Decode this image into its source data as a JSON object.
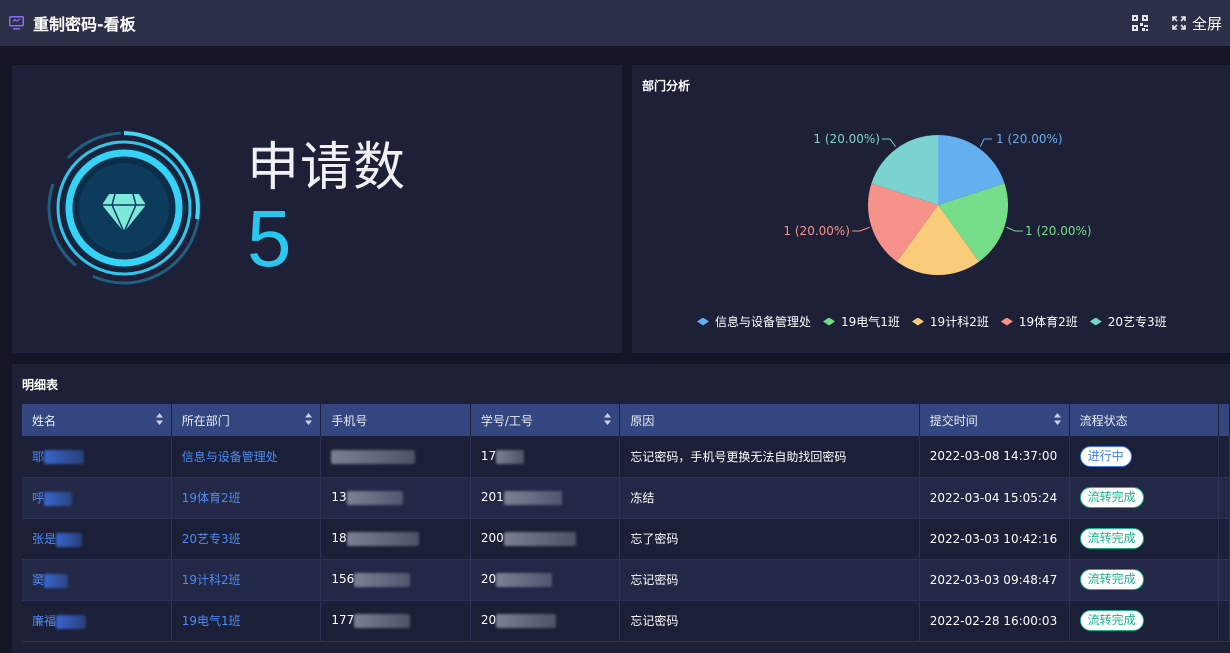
{
  "header": {
    "title": "重制密码-看板",
    "fullscreen_label": "全屏",
    "icons": [
      "monitor-icon",
      "qrcode-icon",
      "fullscreen-icon"
    ]
  },
  "stat": {
    "label": "申请数",
    "value": "5",
    "icon": "diamond-icon"
  },
  "dept_panel": {
    "title": "部门分析",
    "chart_data": {
      "type": "pie",
      "categories": [
        "信息与设备管理处",
        "19电气1班",
        "19计科2班",
        "19体育2班",
        "20艺专3班"
      ],
      "values": [
        1,
        1,
        1,
        1,
        1
      ],
      "labels": [
        "1 (20.00%)",
        "1 (20.00%)",
        "1 (20.00%)",
        "1 (20.00%)",
        "1 (20.00%)"
      ],
      "colors": [
        "#64aff0",
        "#76dd8a",
        "#f8cc7a",
        "#f7928a",
        "#7ad3ce"
      ],
      "legend_position": "bottom"
    }
  },
  "table": {
    "title": "明细表",
    "columns": [
      "姓名",
      "所在部门",
      "手机号",
      "学号/工号",
      "原因",
      "提交时间",
      "流程状态"
    ],
    "rows": [
      {
        "name": "耶",
        "dept": "信息与设备管理处",
        "phone": "",
        "id": "17",
        "reason": "忘记密码，手机号更换无法自助找回密码",
        "time": "2022-03-08 14:37:00",
        "status": "进行中",
        "status_color": "#3d7df2"
      },
      {
        "name": "呼",
        "dept": "19体育2班",
        "phone": "13",
        "id": "201",
        "reason": "冻结",
        "time": "2022-03-04 15:05:24",
        "status": "流转完成",
        "status_color": "#1bb589"
      },
      {
        "name": "张是",
        "dept": "20艺专3班",
        "phone": "18",
        "id": "200",
        "reason": "忘了密码",
        "time": "2022-03-03 10:42:16",
        "status": "流转完成",
        "status_color": "#1bb589"
      },
      {
        "name": "窦",
        "dept": "19计科2班",
        "phone": "156",
        "id": "20",
        "reason": "忘记密码",
        "time": "2022-03-03 09:48:47",
        "status": "流转完成",
        "status_color": "#1bb589"
      },
      {
        "name": "廉福",
        "dept": "19电气1班",
        "phone": "177",
        "id": "20",
        "reason": "忘记密码",
        "time": "2022-02-28 16:00:03",
        "status": "流转完成",
        "status_color": "#1bb589"
      }
    ]
  }
}
